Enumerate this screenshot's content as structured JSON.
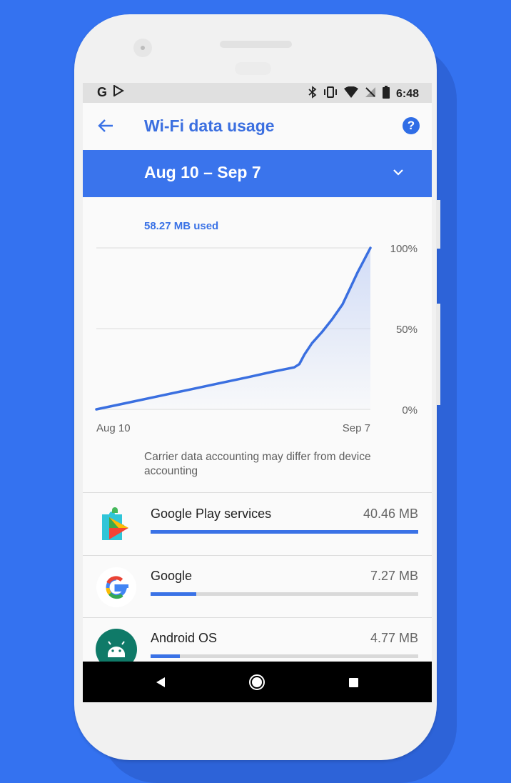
{
  "status": {
    "time": "6:48",
    "icons": [
      "google-g-icon",
      "play-store-icon",
      "bluetooth-icon",
      "vibrate-icon",
      "wifi-icon",
      "no-signal-icon",
      "battery-icon"
    ]
  },
  "appbar": {
    "title": "Wi-Fi data usage",
    "back_icon": "back-arrow-icon",
    "help_icon": "help-icon"
  },
  "cycle": {
    "range": "Aug 10 – Sep 7",
    "dropdown_icon": "chevron-down-icon"
  },
  "usage": {
    "used": "58.27 MB used",
    "note": "Carrier data accounting may differ from device accounting"
  },
  "chart_data": {
    "type": "area",
    "x_start_label": "Aug 10",
    "x_end_label": "Sep 7",
    "y_tick_labels": [
      "100%",
      "50%",
      "0%"
    ],
    "ylim": [
      0,
      100
    ],
    "series": [
      {
        "values": [
          [
            0,
            0
          ],
          [
            12,
            4
          ],
          [
            24,
            8
          ],
          [
            36,
            12
          ],
          [
            48,
            16
          ],
          [
            60,
            20
          ],
          [
            70,
            23.5
          ],
          [
            78,
            26
          ],
          [
            80,
            28
          ],
          [
            82,
            34
          ],
          [
            85,
            41
          ],
          [
            89,
            48
          ],
          [
            93,
            56
          ],
          [
            97,
            65
          ],
          [
            100,
            75
          ],
          [
            103,
            85
          ],
          [
            106,
            94
          ],
          [
            108,
            100
          ]
        ]
      }
    ],
    "x_max": 108,
    "line_color": "#3a6fe0",
    "fill_color": "#d6e1f9",
    "grid": true
  },
  "apps": [
    {
      "name": "Google Play services",
      "size": "40.46 MB",
      "fraction": 1.0,
      "icon": "google-play-services-icon"
    },
    {
      "name": "Google",
      "size": "7.27 MB",
      "fraction": 0.17,
      "icon": "google-g-logo-icon"
    },
    {
      "name": "Android OS",
      "size": "4.77 MB",
      "fraction": 0.11,
      "icon": "android-icon"
    }
  ],
  "colors": {
    "accent": "#3a72e6",
    "background": "#3472f0"
  }
}
